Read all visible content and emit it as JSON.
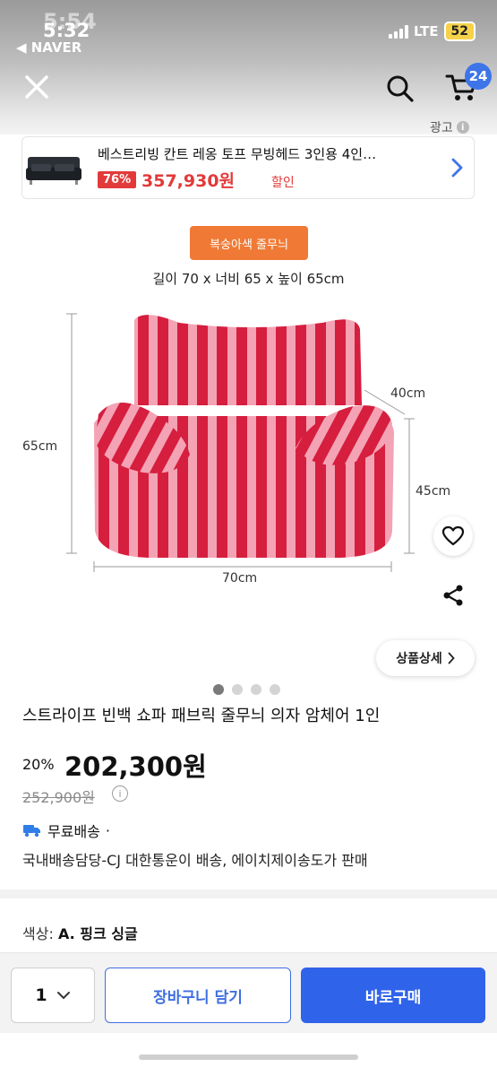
{
  "status_bar": {
    "time": "5:54",
    "time_overlay": "5:32",
    "back_app": "◀ NAVER",
    "network": "LTE",
    "battery": "52"
  },
  "header": {
    "cart_count": "24",
    "ad_label": "광고",
    "ad_info_icon": "i"
  },
  "ad": {
    "title": "베스트리빙 칸트 레옹 토프 무빙헤드 3인용 4인…",
    "discount": "76%",
    "price": "357,930원",
    "sale_text": "할인"
  },
  "product_image": {
    "tag": "복숭아색 줄무늬",
    "dimensions": "길이 70 x 너비 65 x 높이 65cm",
    "dim_height": "65cm",
    "dim_depth": "40cm",
    "dim_seat": "45cm",
    "dim_width": "70cm",
    "detail_button": "상품상세",
    "image_count": 4,
    "active_image": 1
  },
  "product": {
    "title": "스트라이프 빈백 쇼파 패브릭 줄무늬 의자 암체어 1인",
    "discount": "20%",
    "price": "202,300원",
    "original_price": "252,900원",
    "shipping": "무료배송",
    "shipping_sep": "·",
    "seller": "국내배송담당-CJ 대한통운이 배송, 에이치제이송도가 판매"
  },
  "option": {
    "label": "색상:",
    "value": "A. 핑크 싱글"
  },
  "bottom_bar": {
    "quantity": "1",
    "add_to_cart": "장바구니 담기",
    "buy_now": "바로구매"
  },
  "colors": {
    "accent_blue": "#2f63ea",
    "sale_red": "#e23a3a",
    "tag_orange": "#f07a35",
    "stripe_red": "#d61e3f",
    "stripe_pink": "#f3a3b4"
  }
}
